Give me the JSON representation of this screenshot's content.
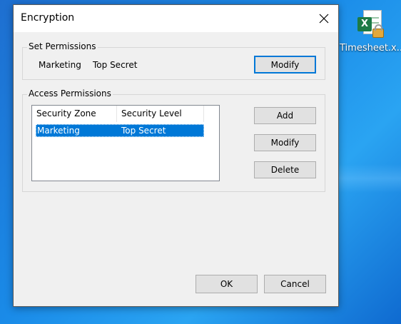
{
  "desktop": {
    "icon_label": "Timesheet.x...",
    "icon_glyph": "X"
  },
  "dialog": {
    "title": "Encryption",
    "close_glyph": "✕",
    "set_permissions": {
      "legend": "Set Permissions",
      "zone": "Marketing",
      "level": "Top Secret",
      "modify_label": "Modify"
    },
    "access_permissions": {
      "legend": "Access Permissions",
      "columns": [
        "Security Zone",
        "Security Level"
      ],
      "rows": [
        {
          "zone": "Marketing",
          "level": "Top Secret",
          "selected": true
        }
      ],
      "add_label": "Add",
      "modify_label": "Modify",
      "delete_label": "Delete"
    },
    "ok_label": "OK",
    "cancel_label": "Cancel"
  },
  "colors": {
    "selection": "#0078d7",
    "desktop_bg": "#1a8be8",
    "default_button_border": "#0078d7"
  }
}
